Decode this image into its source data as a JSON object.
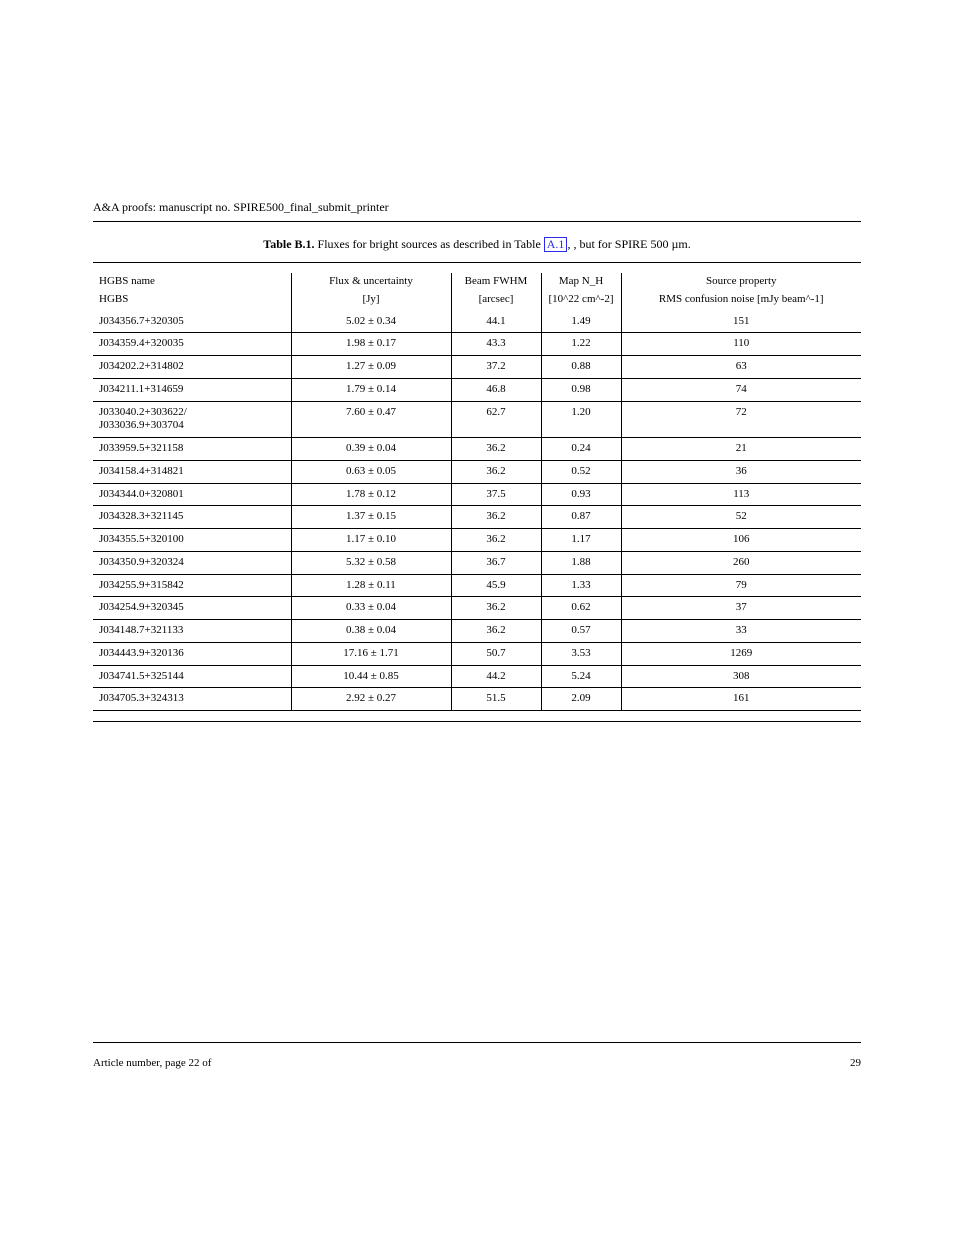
{
  "header": {
    "journal": "A&A proofs:",
    "manuscript": "manuscript no. SPIRE500_final_submit_printer"
  },
  "caption": {
    "table_label": "Table B.1.",
    "text_before_link": "Fluxes for bright sources as described in Table",
    "ref": "A.1",
    "text_after_link": ", but for SPIRE 500 µm."
  },
  "columns": {
    "c1a": "HGBS name",
    "c1b": "HGBS",
    "c2a": "Flux & uncertainty",
    "c2b": "[Jy]",
    "c3a": "Beam FWHM",
    "c3b": "[arcsec]",
    "c4a": "Map N_H",
    "c4b": "[10^22 cm^-2]",
    "c5a": "Source property",
    "c5b": "RMS confusion noise [mJy beam^-1]"
  },
  "rows": [
    {
      "name": "J034356.7+320305",
      "flux": "5.02 ± 0.34",
      "fwhm": "44.1",
      "nh": "1.49",
      "rms": "151"
    },
    {
      "name": "J034359.4+320035",
      "flux": "1.98 ± 0.17",
      "fwhm": "43.3",
      "nh": "1.22",
      "rms": "110"
    },
    {
      "name": "J034202.2+314802",
      "flux": "1.27 ± 0.09",
      "fwhm": "37.2",
      "nh": "0.88",
      "rms": "63"
    },
    {
      "name": "J034211.1+314659",
      "flux": "1.79 ± 0.14",
      "fwhm": "46.8",
      "nh": "0.98",
      "rms": "74"
    },
    {
      "name": "J033040.2+303622/\nJ033036.9+303704",
      "flux": "7.60 ± 0.47",
      "fwhm": "62.7",
      "nh": "1.20",
      "rms": "72"
    },
    {
      "name": "J033959.5+321158",
      "flux": "0.39 ± 0.04",
      "fwhm": "36.2",
      "nh": "0.24",
      "rms": "21"
    },
    {
      "name": "J034158.4+314821",
      "flux": "0.63 ± 0.05",
      "fwhm": "36.2",
      "nh": "0.52",
      "rms": "36"
    },
    {
      "name": "J034344.0+320801",
      "flux": "1.78 ± 0.12",
      "fwhm": "37.5",
      "nh": "0.93",
      "rms": "113"
    },
    {
      "name": "J034328.3+321145",
      "flux": "1.37 ± 0.15",
      "fwhm": "36.2",
      "nh": "0.87",
      "rms": "52"
    },
    {
      "name": "J034355.5+320100",
      "flux": "1.17 ± 0.10",
      "fwhm": "36.2",
      "nh": "1.17",
      "rms": "106"
    },
    {
      "name": "J034350.9+320324",
      "flux": "5.32 ± 0.58",
      "fwhm": "36.7",
      "nh": "1.88",
      "rms": "260"
    },
    {
      "name": "J034255.9+315842",
      "flux": "1.28 ± 0.11",
      "fwhm": "45.9",
      "nh": "1.33",
      "rms": "79"
    },
    {
      "name": "J034254.9+320345",
      "flux": "0.33 ± 0.04",
      "fwhm": "36.2",
      "nh": "0.62",
      "rms": "37"
    },
    {
      "name": "J034148.7+321133",
      "flux": "0.38 ± 0.04",
      "fwhm": "36.2",
      "nh": "0.57",
      "rms": "33"
    },
    {
      "name": "J034443.9+320136",
      "flux": "17.16 ± 1.71",
      "fwhm": "50.7",
      "nh": "3.53",
      "rms": "1269"
    },
    {
      "name": "J034741.5+325144",
      "flux": "10.44 ± 0.85",
      "fwhm": "44.2",
      "nh": "5.24",
      "rms": "308"
    },
    {
      "name": "J034705.3+324313",
      "flux": "2.92 ± 0.27",
      "fwhm": "51.5",
      "nh": "2.09",
      "rms": "161"
    }
  ],
  "footer": {
    "article": "Article number, page 22 of",
    "page": "29"
  }
}
